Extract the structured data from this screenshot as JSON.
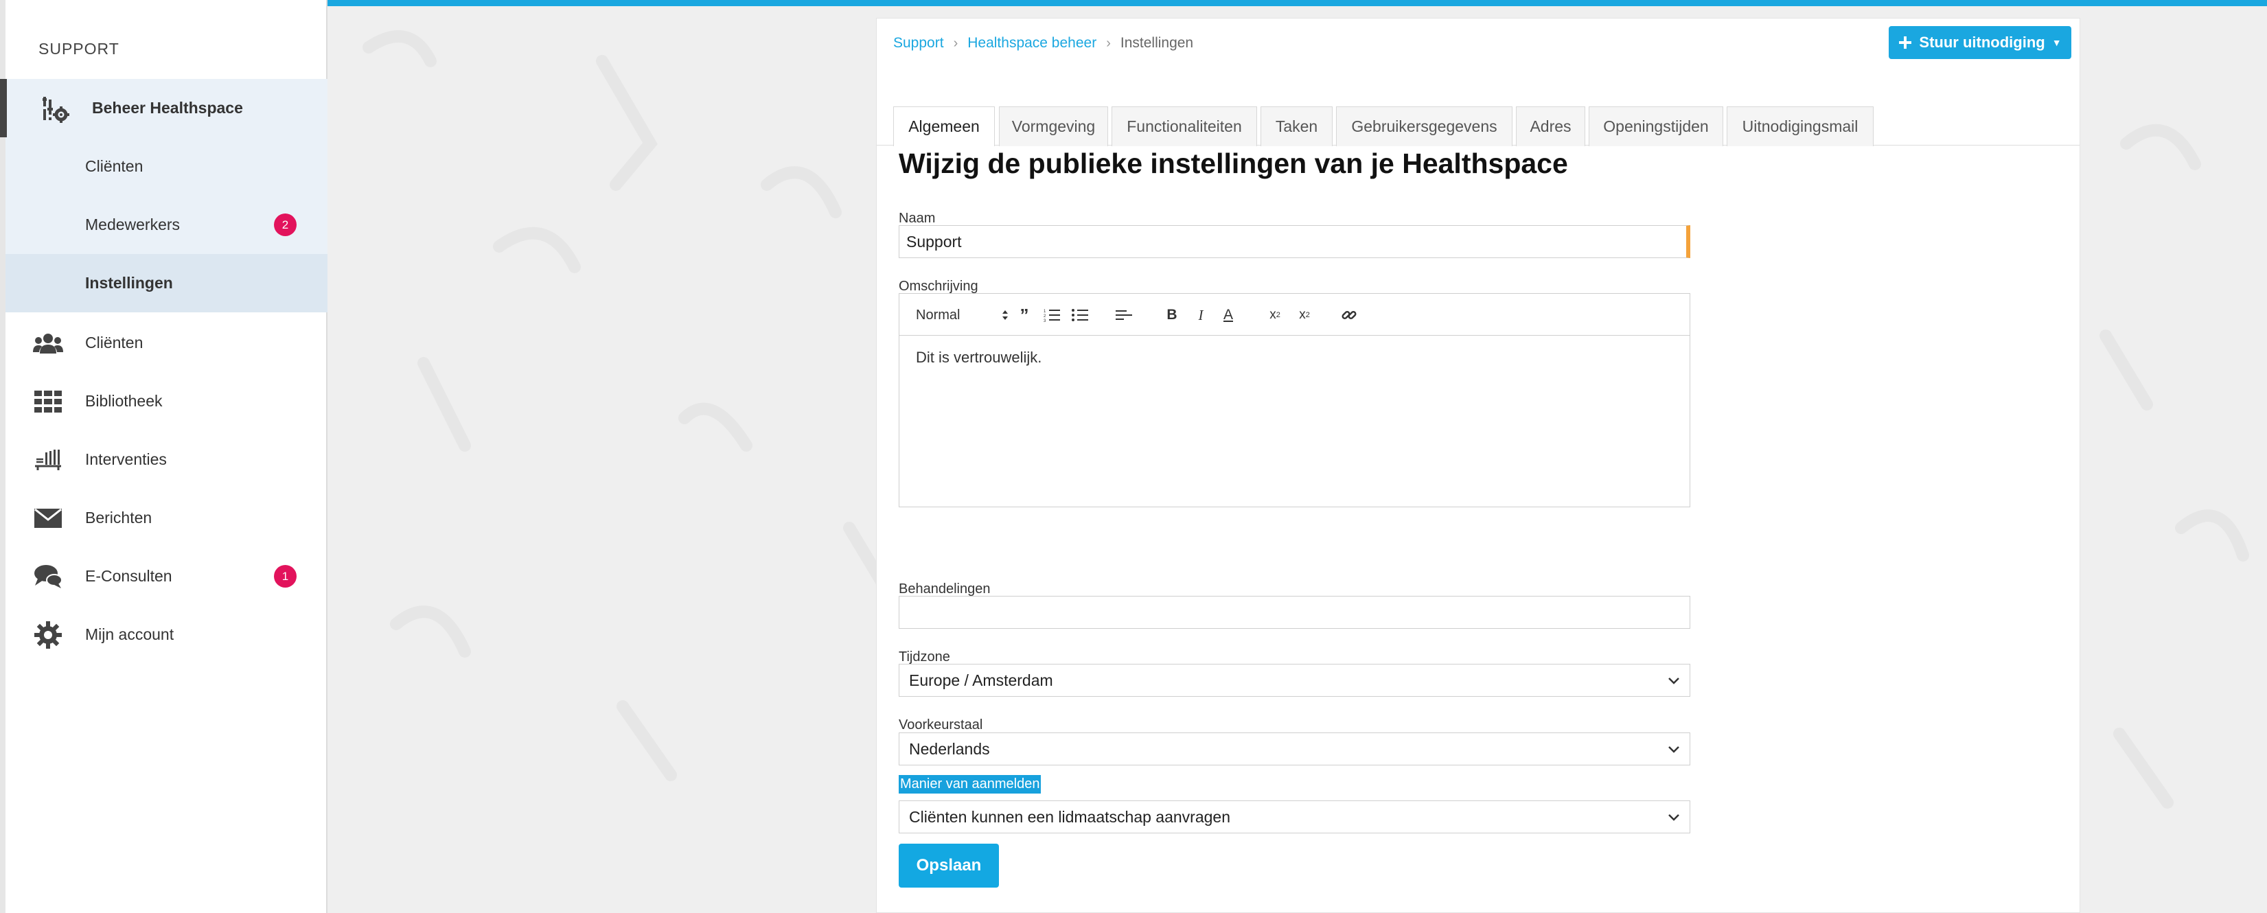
{
  "sidebar": {
    "heading": "SUPPORT",
    "items": [
      {
        "label": "Beheer Healthspace",
        "icon": "healthspace-settings-icon"
      },
      {
        "label": "Cliënten"
      },
      {
        "label": "Medewerkers",
        "badge": "2"
      },
      {
        "label": "Instellingen"
      },
      {
        "label": "Cliënten",
        "icon": "users-icon"
      },
      {
        "label": "Bibliotheek",
        "icon": "grid-icon"
      },
      {
        "label": "Interventies",
        "icon": "interventions-icon"
      },
      {
        "label": "Berichten",
        "icon": "envelope-icon"
      },
      {
        "label": "E-Consulten",
        "icon": "chat-icon",
        "badge": "1"
      },
      {
        "label": "Mijn account",
        "icon": "gear-icon"
      }
    ]
  },
  "breadcrumb": [
    "Support",
    "Healthspace beheer",
    "Instellingen"
  ],
  "invite_button": {
    "label": "Stuur uitnodiging"
  },
  "tabs": [
    "Algemeen",
    "Vormgeving",
    "Functionaliteiten",
    "Taken",
    "Gebruikersgegevens",
    "Adres",
    "Openingstijden",
    "Uitnodigingsmail"
  ],
  "page_title": "Wijzig de publieke instellingen van je Healthspace",
  "form": {
    "name_label": "Naam",
    "name_value": "Support",
    "description_label": "Omschrijving",
    "editor": {
      "format": "Normal",
      "content": "Dit is vertrouwelijk."
    },
    "treatments_label": "Behandelingen",
    "treatments_value": "",
    "timezone_label": "Tijdzone",
    "timezone_value": "Europe / Amsterdam",
    "language_label": "Voorkeurstaal",
    "language_value": "Nederlands",
    "signup_label": "Manier van aanmelden",
    "signup_value": "Cliënten kunnen een lidmaatschap aanvragen",
    "save_label": "Opslaan"
  },
  "colors": {
    "accent": "#1aa7e0",
    "badge": "#e2135c",
    "required": "#f4a23a"
  }
}
